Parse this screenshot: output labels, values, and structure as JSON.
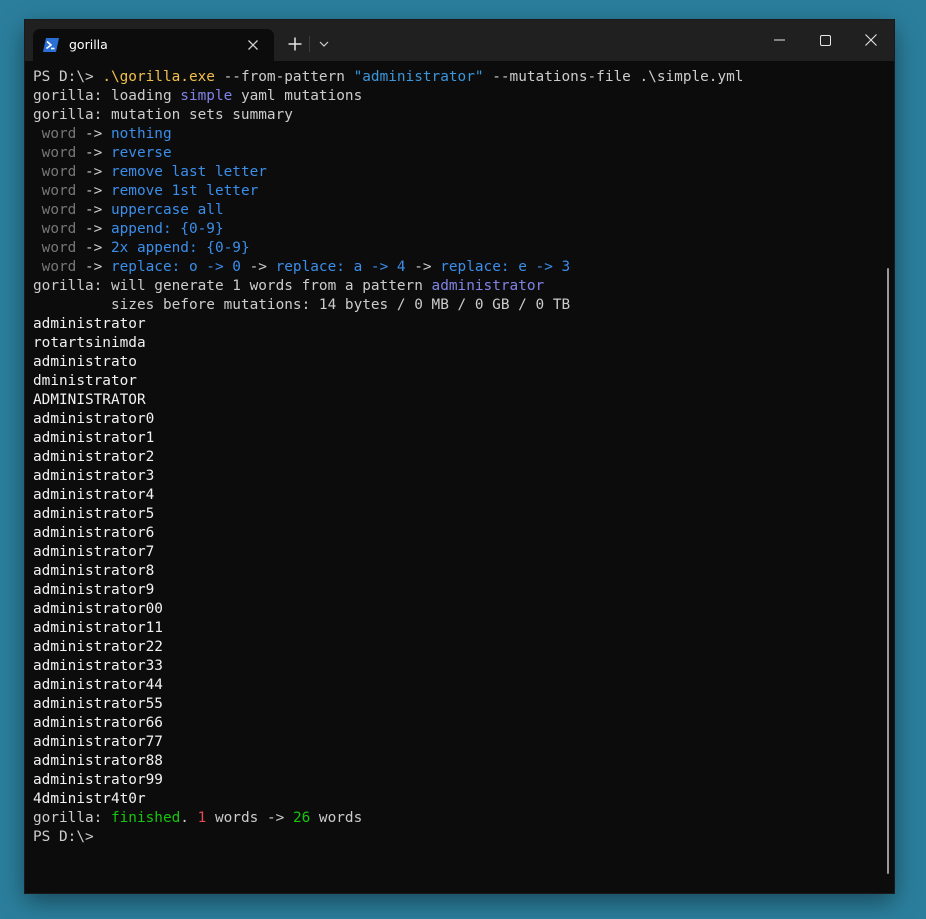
{
  "tab": {
    "title": "gorilla",
    "icon": "powershell-icon"
  },
  "titlebar": {
    "new_tab": "+",
    "colors": {
      "bg": "#202020",
      "tab_bg": "#0c0c0c"
    }
  },
  "terminal": {
    "lines": [
      [
        {
          "t": "PS D:\\> ",
          "c": "default"
        },
        {
          "t": ".\\gorilla.exe",
          "c": "exe"
        },
        {
          "t": " --from-pattern ",
          "c": "default"
        },
        {
          "t": "\"administrator\"",
          "c": "str"
        },
        {
          "t": " --mutations-file .\\simple.yml",
          "c": "default"
        }
      ],
      [
        {
          "t": "gorilla: loading ",
          "c": "default"
        },
        {
          "t": "simple",
          "c": "purple"
        },
        {
          "t": " yaml mutations",
          "c": "default"
        }
      ],
      [
        {
          "t": "gorilla: mutation sets summary",
          "c": "default"
        }
      ],
      [
        {
          "t": " word",
          "c": "gray"
        },
        {
          "t": " -> ",
          "c": "default"
        },
        {
          "t": "nothing",
          "c": "blue"
        }
      ],
      [
        {
          "t": " word",
          "c": "gray"
        },
        {
          "t": " -> ",
          "c": "default"
        },
        {
          "t": "reverse",
          "c": "blue"
        }
      ],
      [
        {
          "t": " word",
          "c": "gray"
        },
        {
          "t": " -> ",
          "c": "default"
        },
        {
          "t": "remove last letter",
          "c": "blue"
        }
      ],
      [
        {
          "t": " word",
          "c": "gray"
        },
        {
          "t": " -> ",
          "c": "default"
        },
        {
          "t": "remove 1st letter",
          "c": "blue"
        }
      ],
      [
        {
          "t": " word",
          "c": "gray"
        },
        {
          "t": " -> ",
          "c": "default"
        },
        {
          "t": "uppercase all",
          "c": "blue"
        }
      ],
      [
        {
          "t": " word",
          "c": "gray"
        },
        {
          "t": " -> ",
          "c": "default"
        },
        {
          "t": "append: {0-9}",
          "c": "blue"
        }
      ],
      [
        {
          "t": " word",
          "c": "gray"
        },
        {
          "t": " -> ",
          "c": "default"
        },
        {
          "t": "2x append: {0-9}",
          "c": "blue"
        }
      ],
      [
        {
          "t": " word",
          "c": "gray"
        },
        {
          "t": " -> ",
          "c": "default"
        },
        {
          "t": "replace: o -> 0",
          "c": "blue"
        },
        {
          "t": " -> ",
          "c": "default"
        },
        {
          "t": "replace: a -> 4",
          "c": "blue"
        },
        {
          "t": " -> ",
          "c": "default"
        },
        {
          "t": "replace: e -> 3",
          "c": "blue"
        }
      ],
      [
        {
          "t": "gorilla: will generate 1 words from a pattern ",
          "c": "default"
        },
        {
          "t": "administrator",
          "c": "purple"
        }
      ],
      [
        {
          "t": "         sizes before mutations: 14 bytes / 0 MB / 0 GB / 0 TB",
          "c": "default"
        }
      ],
      [
        {
          "t": "administrator",
          "c": "white"
        }
      ],
      [
        {
          "t": "rotartsinimda",
          "c": "white"
        }
      ],
      [
        {
          "t": "administrato",
          "c": "white"
        }
      ],
      [
        {
          "t": "dministrator",
          "c": "white"
        }
      ],
      [
        {
          "t": "ADMINISTRATOR",
          "c": "white"
        }
      ],
      [
        {
          "t": "administrator0",
          "c": "white"
        }
      ],
      [
        {
          "t": "administrator1",
          "c": "white"
        }
      ],
      [
        {
          "t": "administrator2",
          "c": "white"
        }
      ],
      [
        {
          "t": "administrator3",
          "c": "white"
        }
      ],
      [
        {
          "t": "administrator4",
          "c": "white"
        }
      ],
      [
        {
          "t": "administrator5",
          "c": "white"
        }
      ],
      [
        {
          "t": "administrator6",
          "c": "white"
        }
      ],
      [
        {
          "t": "administrator7",
          "c": "white"
        }
      ],
      [
        {
          "t": "administrator8",
          "c": "white"
        }
      ],
      [
        {
          "t": "administrator9",
          "c": "white"
        }
      ],
      [
        {
          "t": "administrator00",
          "c": "white"
        }
      ],
      [
        {
          "t": "administrator11",
          "c": "white"
        }
      ],
      [
        {
          "t": "administrator22",
          "c": "white"
        }
      ],
      [
        {
          "t": "administrator33",
          "c": "white"
        }
      ],
      [
        {
          "t": "administrator44",
          "c": "white"
        }
      ],
      [
        {
          "t": "administrator55",
          "c": "white"
        }
      ],
      [
        {
          "t": "administrator66",
          "c": "white"
        }
      ],
      [
        {
          "t": "administrator77",
          "c": "white"
        }
      ],
      [
        {
          "t": "administrator88",
          "c": "white"
        }
      ],
      [
        {
          "t": "administrator99",
          "c": "white"
        }
      ],
      [
        {
          "t": "4dministr4t0r",
          "c": "white"
        }
      ],
      [
        {
          "t": "gorilla: ",
          "c": "default"
        },
        {
          "t": "finished",
          "c": "green"
        },
        {
          "t": ". ",
          "c": "default"
        },
        {
          "t": "1",
          "c": "red"
        },
        {
          "t": " words -> ",
          "c": "default"
        },
        {
          "t": "26",
          "c": "green"
        },
        {
          "t": " words",
          "c": "default"
        }
      ],
      [
        {
          "t": "PS D:\\>",
          "c": "default"
        }
      ]
    ]
  }
}
